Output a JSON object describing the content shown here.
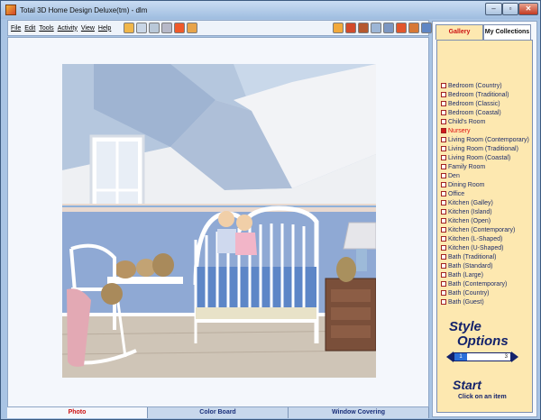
{
  "window": {
    "title": "Total 3D Home Design Deluxe(tm) - dlm"
  },
  "menu": [
    "File",
    "Edit",
    "Tools",
    "Activity",
    "View",
    "Help"
  ],
  "toolbar": {
    "left_icons": [
      "new-plan-icon",
      "open-icon",
      "gallery-icon",
      "color-icon",
      "help-icon",
      "cursor-help-icon"
    ],
    "right_icons": [
      "wall-icon",
      "paint-icon",
      "furniture-icon",
      "window-icon",
      "cart-icon",
      "shopping-icon",
      "bag-icon",
      "export-icon"
    ]
  },
  "bottom_tabs": [
    "Photo",
    "Color Board",
    "Window Covering"
  ],
  "side": {
    "tabs": [
      "Gallery",
      "My Collections"
    ],
    "items": [
      "Bedroom (Country)",
      "Bedroom (Traditional)",
      "Bedroom (Classic)",
      "Bedroom (Coastal)",
      "Child's Room",
      "Nursery",
      "Living Room (Contemporary)",
      "Living Room (Traditional)",
      "Living Room (Coastal)",
      "Family Room",
      "Den",
      "Dining Room",
      "Office",
      "Kitchen (Galley)",
      "Kitchen (Island)",
      "Kitchen (Open)",
      "Kitchen (Contemporary)",
      "Kitchen (L-Shaped)",
      "Kitchen (U-Shaped)",
      "Bath (Traditional)",
      "Bath (Standard)",
      "Bath (Large)",
      "Bath (Contemporary)",
      "Bath (Country)",
      "Bath (Guest)"
    ],
    "selected": "Nursery",
    "style_line1": "Style",
    "style_line2": "Options",
    "slider_value": "1",
    "slider_max": "3",
    "start": "Start",
    "start_hint": "Click on an item"
  },
  "colors": {
    "accent": "#13226b",
    "selected": "#e01010",
    "panel": "#fde8b0"
  }
}
